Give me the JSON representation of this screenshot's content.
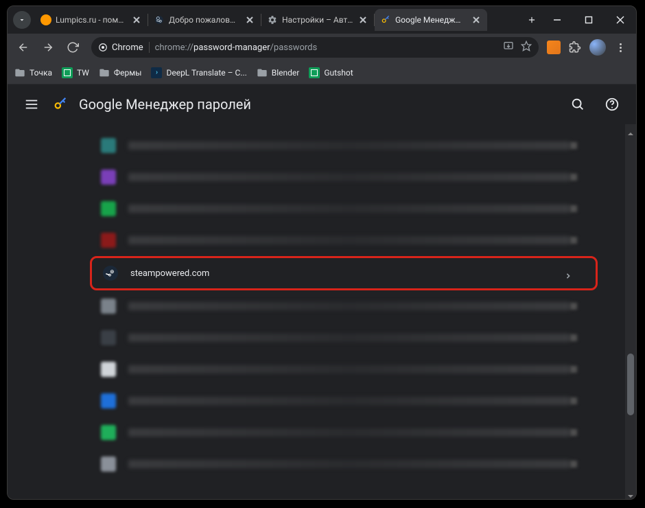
{
  "tabs": [
    {
      "title": "Lumpics.ru - пом…",
      "favicon_color": "#ff9800"
    },
    {
      "title": "Добро пожалов…",
      "favicon_color": "#1b2838"
    },
    {
      "title": "Настройки – Авт…",
      "favicon_color": "#9aa0a6"
    },
    {
      "title": "Google Менедж…",
      "favicon_color": "#4285f4"
    }
  ],
  "active_tab_index": 3,
  "omnibox": {
    "chip": "Chrome",
    "prefix": "chrome://",
    "bold": "password-manager",
    "rest": "/passwords"
  },
  "bookmarks": [
    {
      "label": "Точка",
      "kind": "folder"
    },
    {
      "label": "TW",
      "kind": "sheets"
    },
    {
      "label": "Фермы",
      "kind": "folder"
    },
    {
      "label": "DeepL Translate – С...",
      "kind": "deepl"
    },
    {
      "label": "Blender",
      "kind": "folder"
    },
    {
      "label": "Gutshot",
      "kind": "sheets"
    }
  ],
  "app": {
    "title": "Google Менеджер паролей"
  },
  "passwords": {
    "highlight_label": "steampowered.com",
    "blurred_icons": [
      "#2a7a7a",
      "#7a3fb8",
      "#17a34a",
      "#8b1a1a",
      "#7a828a",
      "#3a3f46",
      "#d0d4d9",
      "#1e6fd9",
      "#1fae5a",
      "#8a9099"
    ],
    "highlight_index": 4
  }
}
